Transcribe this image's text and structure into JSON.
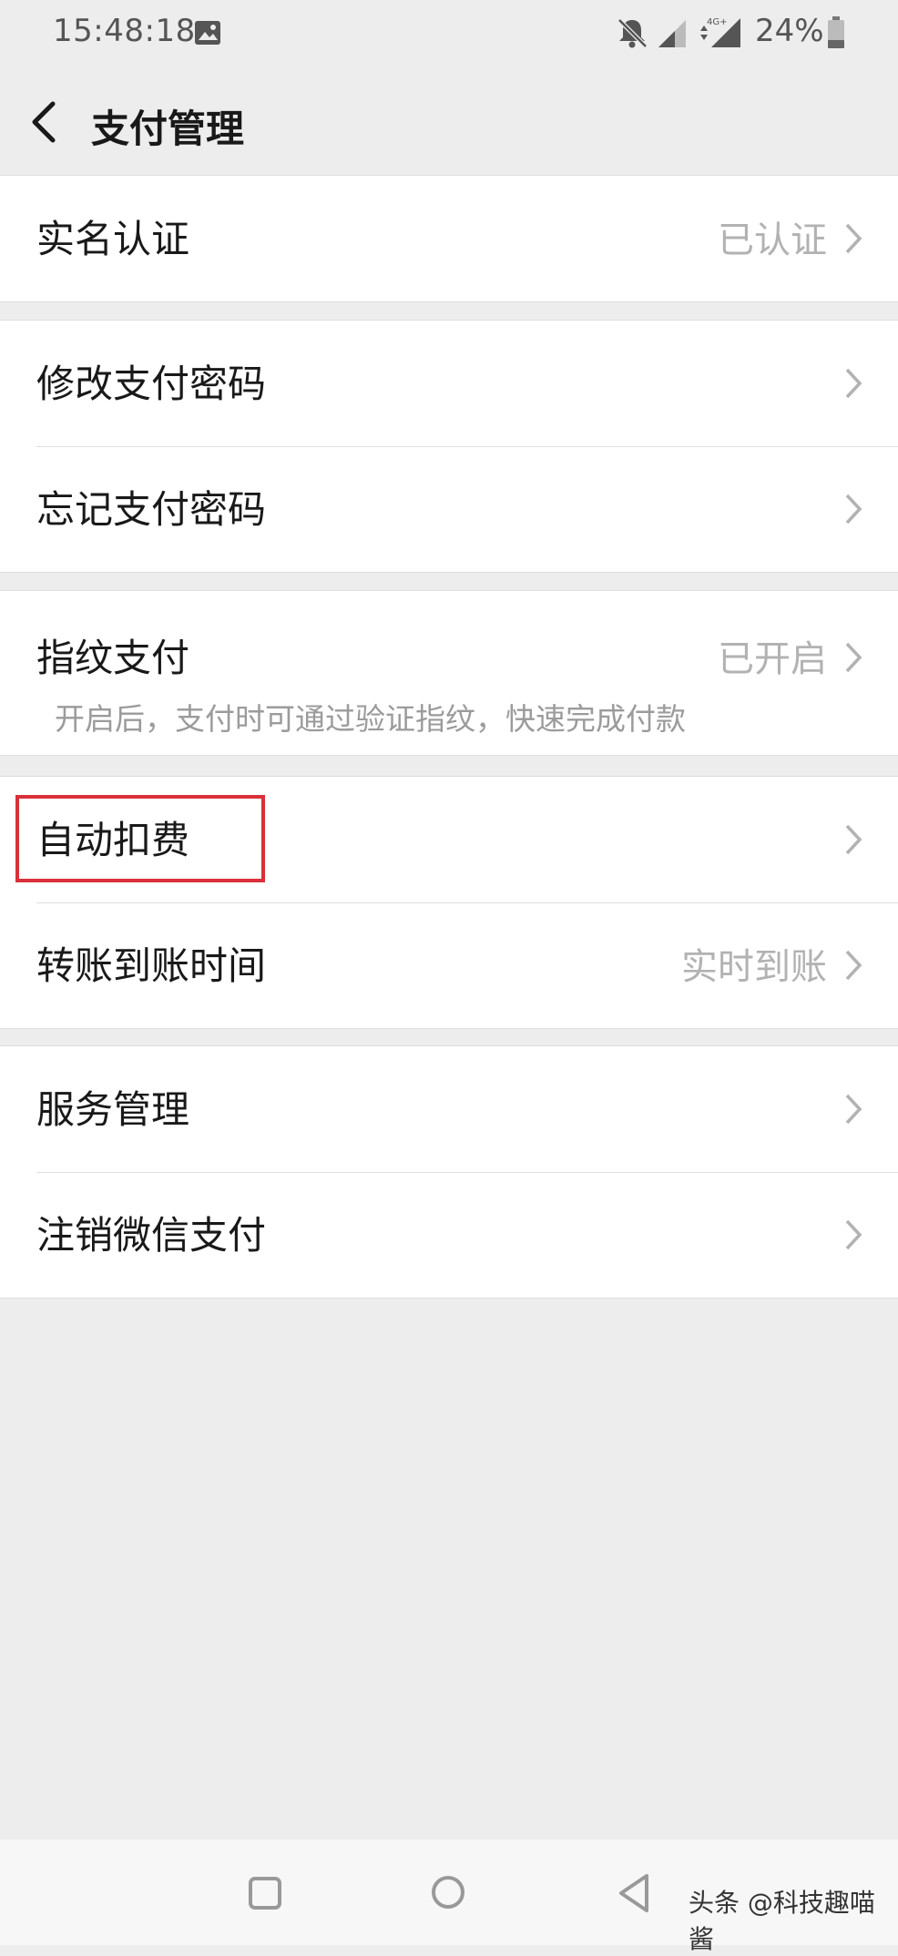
{
  "status_bar": {
    "time": "15:48:18",
    "battery": "24%",
    "network": "4G+",
    "icons": [
      "gallery-icon",
      "mute-icon",
      "signal-icon",
      "battery-icon"
    ]
  },
  "nav": {
    "title": "支付管理",
    "back_icon": "back-chevron-icon"
  },
  "groups": [
    {
      "items": [
        {
          "label": "实名认证",
          "value": "已认证"
        }
      ]
    },
    {
      "items": [
        {
          "label": "修改支付密码",
          "value": ""
        },
        {
          "label": "忘记支付密码",
          "value": ""
        }
      ]
    },
    {
      "items": [
        {
          "label": "指纹支付",
          "value": "已开启",
          "description": "开启后，支付时可通过验证指纹，快速完成付款"
        }
      ]
    },
    {
      "items": [
        {
          "label": "自动扣费",
          "value": "",
          "highlighted": true
        },
        {
          "label": "转账到账时间",
          "value": "实时到账"
        }
      ]
    },
    {
      "items": [
        {
          "label": "服务管理",
          "value": ""
        },
        {
          "label": "注销微信支付",
          "value": ""
        }
      ]
    }
  ],
  "highlight_color": "#d9303a",
  "system_nav": {
    "icons": [
      "recents-icon",
      "home-icon",
      "back-icon"
    ],
    "watermark": "头条 @科技趣喵酱"
  }
}
